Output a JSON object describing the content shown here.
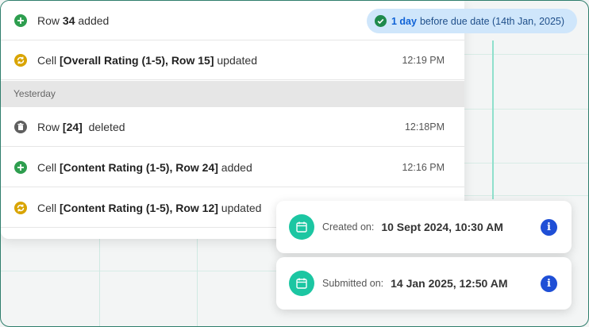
{
  "activity": {
    "rows_today": [
      {
        "id": "row34",
        "icon": "plus-circle-icon",
        "pre": "Row ",
        "bold": "34",
        "post": " added",
        "time": ""
      },
      {
        "id": "cell-overall",
        "icon": "refresh-circle-icon",
        "pre": "Cell ",
        "bold": "[Overall Rating (1-5), Row 15]",
        "post": " updated",
        "time": "12:19 PM"
      }
    ],
    "section_label": "Yesterday",
    "rows_yesterday": [
      {
        "id": "row24",
        "icon": "trash-circle-icon",
        "pre": "Row ",
        "bold": "[24]",
        "post": "  deleted",
        "time": "12:18PM"
      },
      {
        "id": "cell-content-24",
        "icon": "plus-circle-icon",
        "pre": "Cell ",
        "bold": "[Content Rating (1-5), Row 24]",
        "post": " added",
        "time": "12:16 PM"
      },
      {
        "id": "cell-content-12",
        "icon": "refresh-circle-icon",
        "pre": "Cell ",
        "bold": "[Content Rating (1-5), Row 12]",
        "post": " updated",
        "time": ""
      }
    ]
  },
  "due_badge": {
    "icon": "check-circle-icon",
    "strong": "1 day",
    "rest": "before due date (14th Jan, 2025)"
  },
  "info_cards": [
    {
      "label": "Created on:",
      "value": "10 Sept 2024, 10:30 AM"
    },
    {
      "label": "Submitted on:",
      "value": "14 Jan 2025, 12:50 AM"
    }
  ],
  "colors": {
    "accent_teal": "#1cc6a2",
    "added_green": "#2e9e4f",
    "updated_gold": "#d9a400",
    "deleted_gray": "#5f5f5f",
    "badge_blue": "#0f62d6",
    "info_blue": "#1f4fd6"
  }
}
